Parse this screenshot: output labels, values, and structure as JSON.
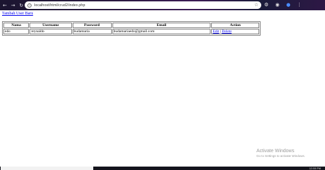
{
  "browser": {
    "url": "localhost/html/crud2/index.php",
    "info_icon": "info-icon",
    "star_icon": "star-icon"
  },
  "page": {
    "link_text": "Tambah User Baru"
  },
  "table": {
    "headers": {
      "nama": "Nama",
      "username": "Username",
      "password": "Password",
      "email": "Email",
      "action": "Action"
    },
    "rows": [
      {
        "nama": "edo",
        "username": "reynaldo",
        "password": "budamaria",
        "email": "budamariaedo@gmail.com",
        "edit": "Edit",
        "separator": "|",
        "delete": "Delete"
      }
    ]
  },
  "watermark": {
    "title": "Activate Windows",
    "subtitle": "Go to Settings to activate Windows."
  },
  "taskbar": {
    "clock": "12:55 PM"
  }
}
